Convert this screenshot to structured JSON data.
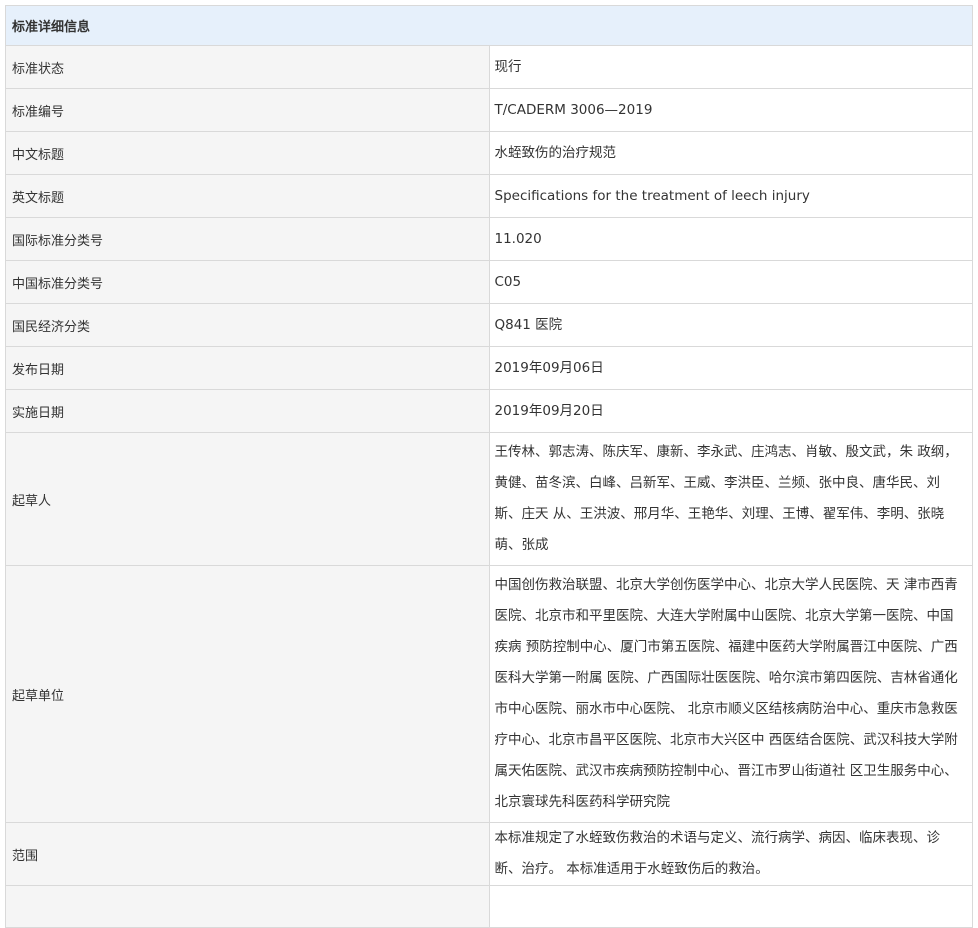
{
  "header": {
    "title": "标准详细信息"
  },
  "fields": [
    {
      "label": "标准状态",
      "value": "现行"
    },
    {
      "label": "标准编号",
      "value": "T/CADERM 3006—2019"
    },
    {
      "label": "中文标题",
      "value": "水蛭致伤的治疗规范"
    },
    {
      "label": "英文标题",
      "value": "Specifications for the treatment of leech injury"
    },
    {
      "label": "国际标准分类号",
      "value": "11.020"
    },
    {
      "label": "中国标准分类号",
      "value": "C05"
    },
    {
      "label": "国民经济分类",
      "value": "Q841 医院"
    },
    {
      "label": "发布日期",
      "value": "2019年09月06日"
    },
    {
      "label": "实施日期",
      "value": "2019年09月20日"
    },
    {
      "label": "起草人",
      "value": "王传林、郭志涛、陈庆军、康新、李永武、庄鸿志、肖敏、殷文武，朱 政纲，黄健、苗冬滨、白峰、吕新军、王威、李洪臣、兰频、张中良、唐华民、刘斯、庄天 从、王洪波、邢月华、王艳华、刘理、王博、翟军伟、李明、张晓萌、张成"
    },
    {
      "label": "起草单位",
      "value": "中国创伤救治联盟、北京大学创伤医学中心、北京大学人民医院、天 津市西青医院、北京市和平里医院、大连大学附属中山医院、北京大学第一医院、中国疾病 预防控制中心、厦门市第五医院、福建中医药大学附属晋江中医院、广西医科大学第一附属 医院、广西国际壮医医院、哈尔滨市第四医院、吉林省通化市中心医院、丽水市中心医院、 北京市顺义区结核病防治中心、重庆市急救医疗中心、北京市昌平区医院、北京市大兴区中 西医结合医院、武汉科技大学附属天佑医院、武汉市疾病预防控制中心、晋江市罗山街道社 区卫生服务中心、北京寰球先科医药科学研究院"
    },
    {
      "label": "范围",
      "value": "本标准规定了水蛭致伤救治的术语与定义、流行病学、病因、临床表现、诊断、治疗。 本标准适用于水蛭致伤后的救治。"
    }
  ]
}
